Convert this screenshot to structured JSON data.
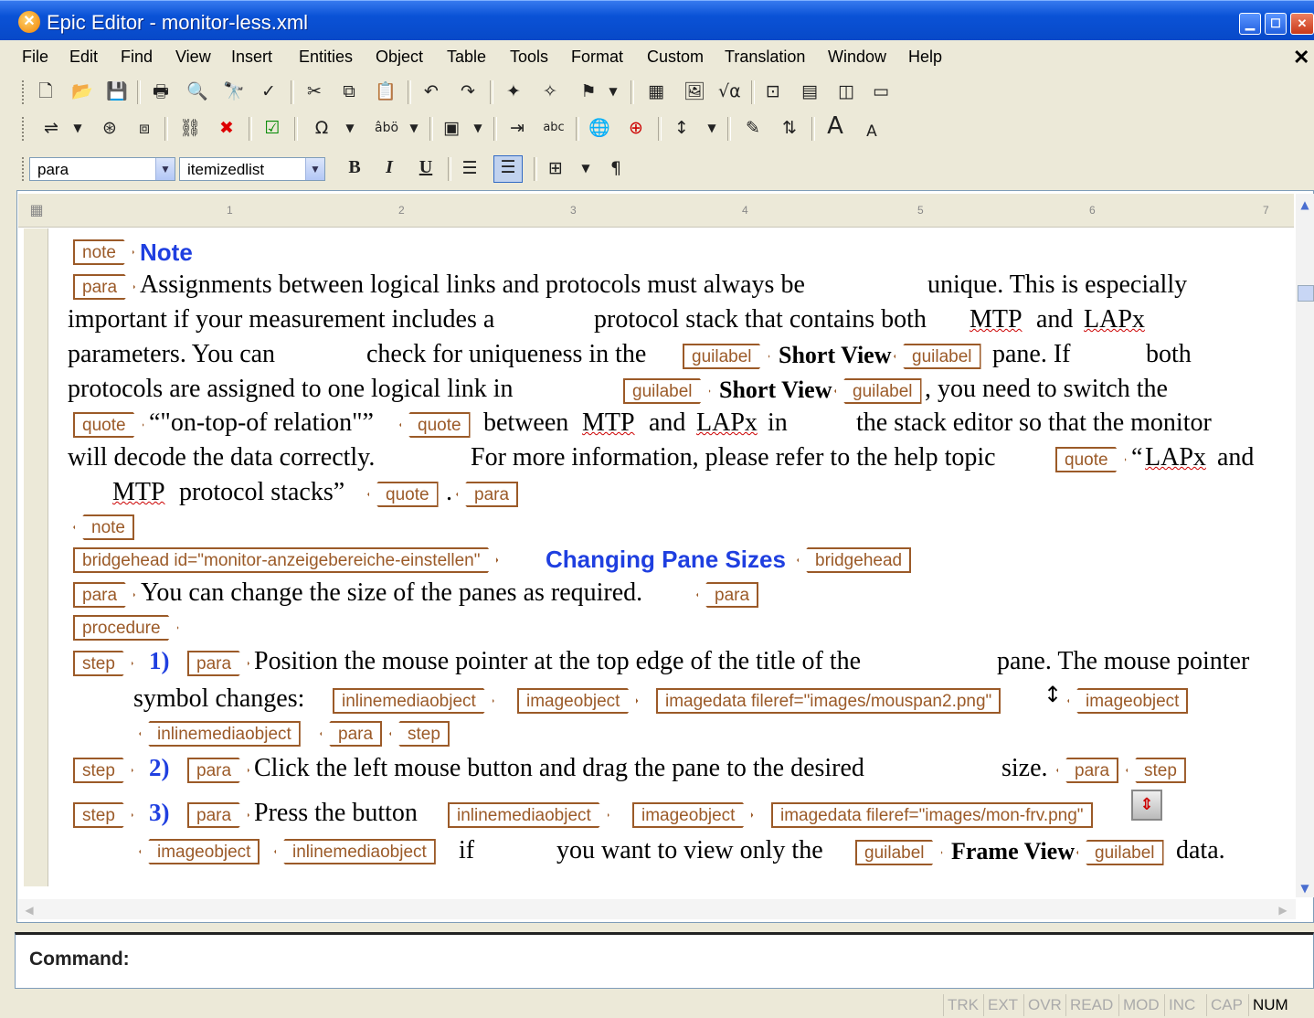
{
  "window": {
    "title": "Epic Editor - monitor-less.xml"
  },
  "menu": [
    "File",
    "Edit",
    "Find",
    "View",
    "Insert",
    "Entities",
    "Object",
    "Table",
    "Tools",
    "Format",
    "Custom",
    "Translation",
    "Window",
    "Help"
  ],
  "format_bar": {
    "element_select": "para",
    "list_select": "itemizedlist"
  },
  "ruler": [
    "1",
    "2",
    "3",
    "4",
    "5",
    "6",
    "7"
  ],
  "document": {
    "note_tag": "note",
    "note_title": "Note",
    "para_tag": "para",
    "quote_tag": "quote",
    "guilabel_tag": "guilabel",
    "l1": "Assignments between logical links and protocols must always be",
    "l1b": "unique. This is especially",
    "l2a": "important if your measurement includes a",
    "l2b": "protocol stack that contains both",
    "mtp": "MTP",
    "and": "and",
    "lapx": "LAPx",
    "l3a": "parameters. You can",
    "l3b": "check for uniqueness in the",
    "short_view": "Short View",
    "l3c": "pane. If",
    "l3d": "both",
    "l4a": "protocols are assigned to one logical link in",
    "l4b": ", you need to switch the",
    "quote1": "“\"on-top-of relation\"”",
    "l5a": "between",
    "l5b": "in",
    "l5c": "the stack editor so that the monitor",
    "l6a": "will decode the data correctly.",
    "l6b": "For more information, please refer to the help topic",
    "quote2a": "“",
    "l7b": "protocol stacks”",
    "period": ".",
    "bridgehead_tag_open": "bridgehead id=\"monitor-anzeigebereiche-einstellen\"",
    "bridgehead_title": "Changing Pane Sizes",
    "bridgehead_tag_close": "bridgehead",
    "p2": "You can change the size of the panes as required.",
    "procedure_tag": "procedure",
    "step_tag": "step",
    "s1num": "1)",
    "s1a": "Position the mouse pointer at the top edge of the title of the",
    "s1b": "pane. The mouse pointer",
    "s1c": "symbol changes:",
    "inlinemediaobject_tag": "inlinemediaobject",
    "imageobject_tag": "imageobject",
    "imagedata1": "imagedata fileref=\"images/mouspan2.png\"",
    "s2num": "2)",
    "s2a": "Click the left mouse button and drag the pane to the desired",
    "s2b": "size.",
    "s3num": "3)",
    "s3a": "Press the button",
    "imagedata2": "imagedata fileref=\"images/mon-frv.png\"",
    "s3b": "if",
    "s3c": "you want to view only the",
    "frame_view": "Frame View",
    "s3d": "data."
  },
  "command": {
    "label": "Command:"
  },
  "status": [
    "TRK",
    "EXT",
    "OVR",
    "READ",
    "MOD",
    "INC",
    "CAP",
    "NUM"
  ],
  "colors": {
    "title_bar": "#0a52d6",
    "tag_border": "#9b5a28",
    "heading": "#1f3fe0"
  }
}
